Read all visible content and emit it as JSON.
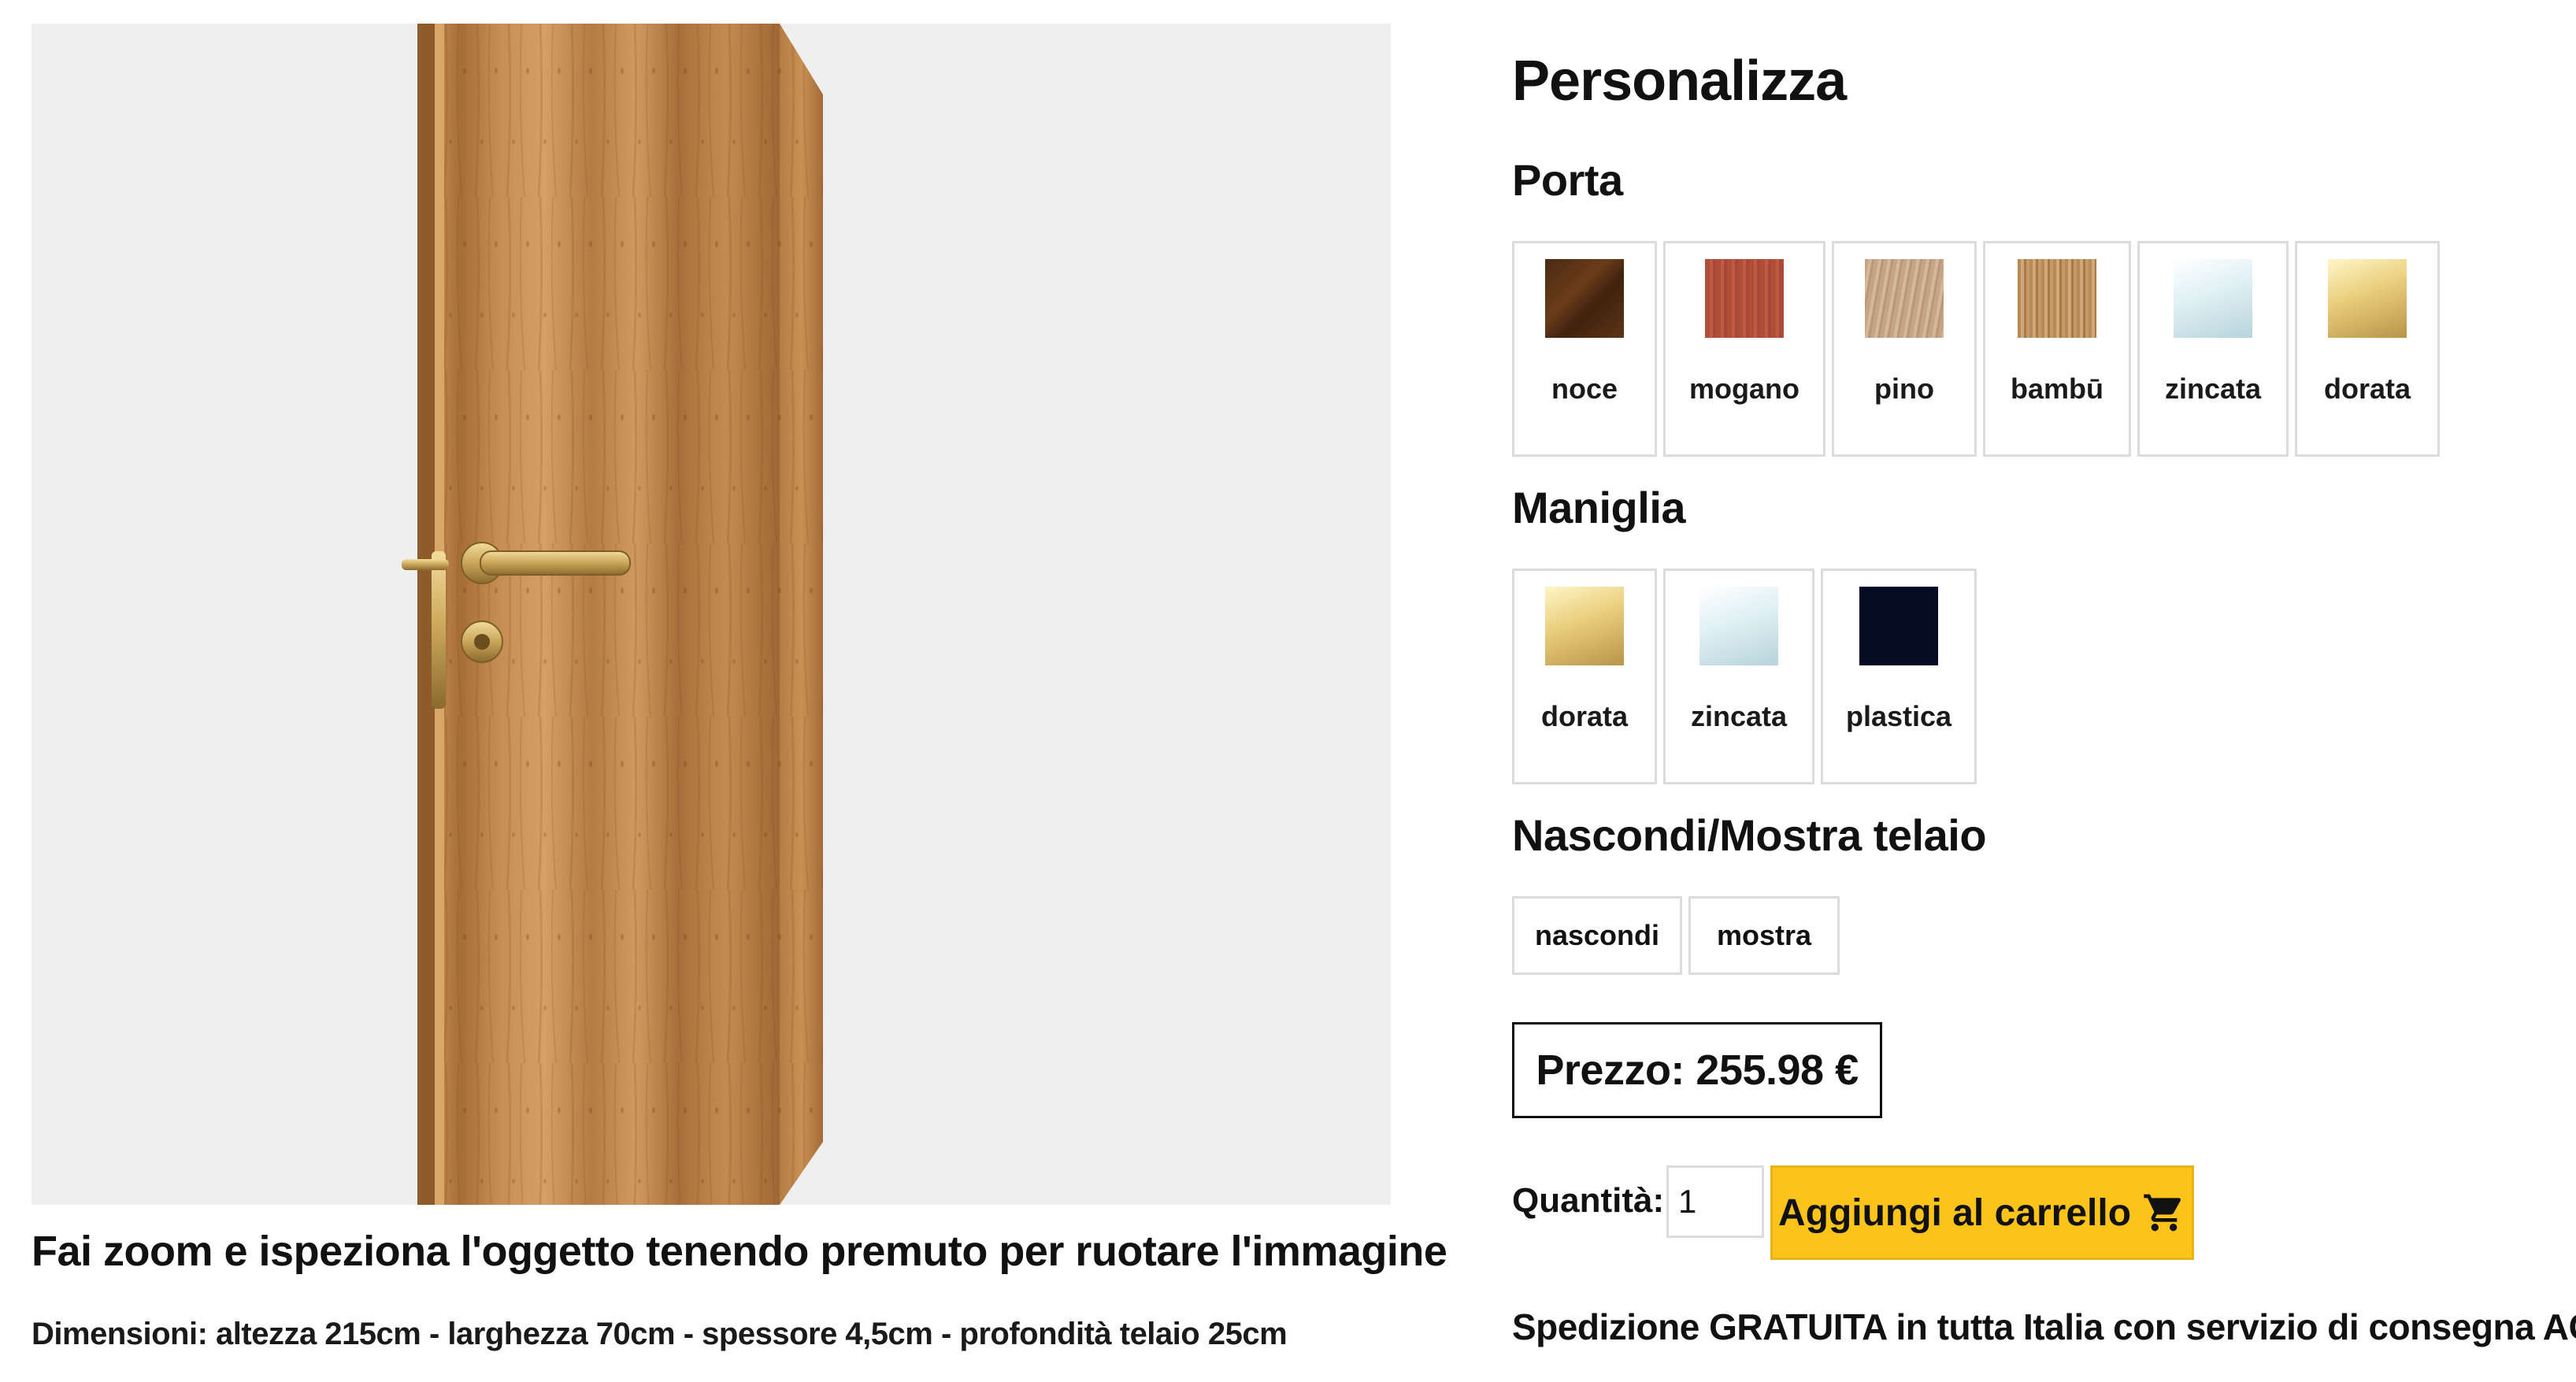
{
  "viewer": {
    "caption": "Fai zoom e ispeziona l'oggetto tenendo premuto per ruotare l'immagine",
    "dimensions": "Dimensioni: altezza 215cm - larghezza 70cm - spessore 4,5cm - profondità telaio 25cm"
  },
  "customize": {
    "title": "Personalizza",
    "door": {
      "heading": "Porta",
      "options": [
        {
          "label": "noce",
          "icon": "noce-wood-swatch"
        },
        {
          "label": "mogano",
          "icon": "mogano-wood-swatch"
        },
        {
          "label": "pino",
          "icon": "pino-wood-swatch"
        },
        {
          "label": "bambū",
          "icon": "bambu-wood-swatch"
        },
        {
          "label": "zincata",
          "icon": "zinc-metal-swatch"
        },
        {
          "label": "dorata",
          "icon": "gold-metal-swatch"
        }
      ]
    },
    "handle": {
      "heading": "Maniglia",
      "options": [
        {
          "label": "dorata",
          "icon": "gold-metal-swatch"
        },
        {
          "label": "zincata",
          "icon": "zinc-metal-swatch"
        },
        {
          "label": "plastica",
          "icon": "black-plastic-swatch"
        }
      ]
    },
    "frame": {
      "heading": "Nascondi/Mostra telaio",
      "options": [
        "nascondi",
        "mostra"
      ]
    }
  },
  "price": {
    "text": "Prezzo: 255.98 €"
  },
  "quantity": {
    "label": "Quantità:",
    "value": "1"
  },
  "cart": {
    "label": "Aggiungi al carrello",
    "icon": "cart-icon",
    "color": "#fcc418"
  },
  "shipping": {
    "text": "Spedizione GRATUITA in tutta Italia con servizio di consegna ACME"
  }
}
